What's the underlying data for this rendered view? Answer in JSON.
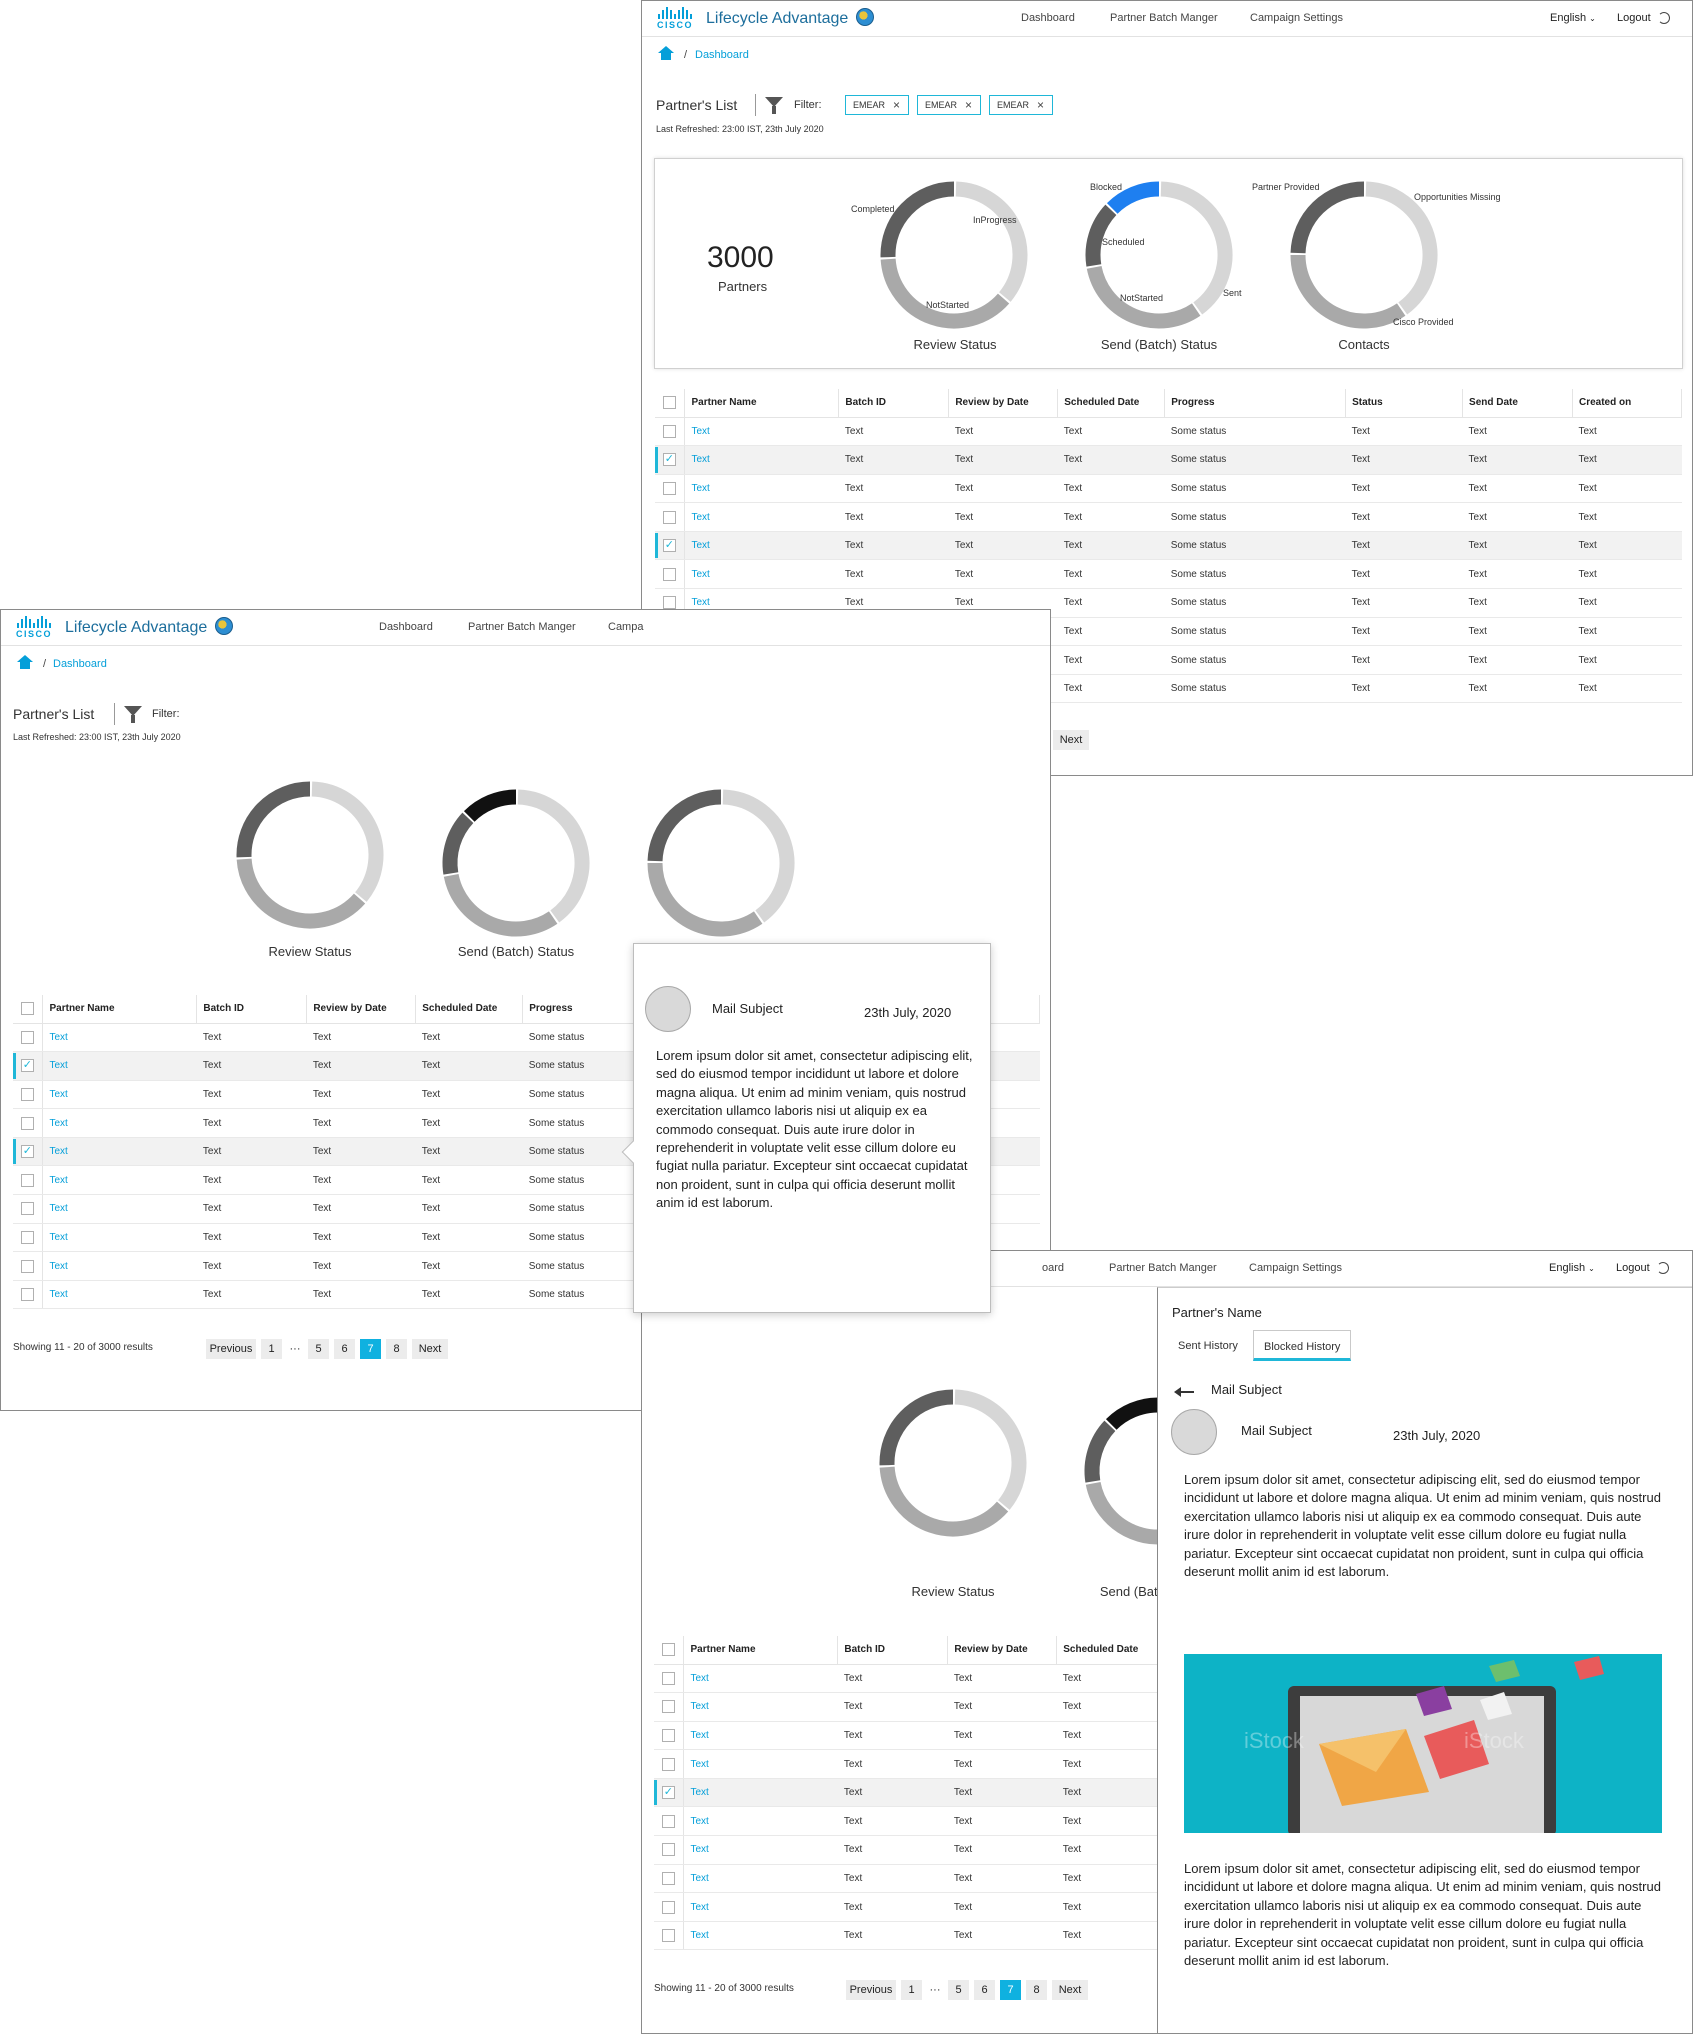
{
  "app": {
    "name": "Lifecycle Advantage",
    "nav": [
      "Dashboard",
      "Partner Batch Manger",
      "Campaign Settings"
    ],
    "nav_clipped": "Campa",
    "nav_clipped_left": "oard",
    "language": "English",
    "logout": "Logout",
    "logo_text": "CISCO"
  },
  "breadcrumb": {
    "current": "Dashboard",
    "separator": "/"
  },
  "list": {
    "title": "Partner's List",
    "filter_label": "Filter:",
    "chips": [
      "EMEAR",
      "EMEAR",
      "EMEAR"
    ],
    "last_refreshed": "Last Refreshed: 23:00 IST, 23th July 2020"
  },
  "summary": {
    "total": "3000",
    "total_label": "Partners",
    "charts": [
      {
        "title": "Review Status",
        "labels": [
          "Completed",
          "InProgress",
          "NotStarted"
        ],
        "segments": [
          {
            "label": "InProgress",
            "value": 0.36,
            "color": "#d6d6d6"
          },
          {
            "label": "NotStarted",
            "value": 0.38,
            "color": "#a9a9a9"
          },
          {
            "label": "Completed",
            "value": 0.26,
            "color": "#5e5e5e"
          }
        ]
      },
      {
        "title": "Send (Batch) Status",
        "labels": [
          "Blocked",
          "Scheduled",
          "NotStarted",
          "Sent"
        ],
        "segments": [
          {
            "label": "Sent",
            "value": 0.4,
            "color": "#d6d6d6"
          },
          {
            "label": "NotStarted",
            "value": 0.32,
            "color": "#a9a9a9"
          },
          {
            "label": "Scheduled",
            "value": 0.15,
            "color": "#5e5e5e"
          },
          {
            "label": "Blocked",
            "value": 0.13,
            "color": "#1e7ff0"
          }
        ]
      },
      {
        "title": "Contacts",
        "labels": [
          "Partner Provided",
          "Opportunities Missing",
          "Cisco Provided"
        ],
        "segments": [
          {
            "label": "Opportunities Missing",
            "value": 0.4,
            "color": "#d6d6d6"
          },
          {
            "label": "Cisco Provided",
            "value": 0.35,
            "color": "#a9a9a9"
          },
          {
            "label": "Partner Provided",
            "value": 0.25,
            "color": "#5e5e5e"
          }
        ]
      }
    ]
  },
  "table": {
    "columns": [
      "Partner Name",
      "Batch ID",
      "Review by Date",
      "Scheduled Date",
      "Progress",
      "Status",
      "Send Date",
      "Created on"
    ],
    "column_clipped": "on",
    "rows": [
      [
        "Text",
        "Text",
        "Text",
        "Text",
        "Some status",
        "Text",
        "Text",
        "Text"
      ],
      [
        "Text",
        "Text",
        "Text",
        "Text",
        "Some status",
        "Text",
        "Text",
        "Text"
      ],
      [
        "Text",
        "Text",
        "Text",
        "Text",
        "Some status",
        "Text",
        "Text",
        "Text"
      ],
      [
        "Text",
        "Text",
        "Text",
        "Text",
        "Some status",
        "Text",
        "Text",
        "Text"
      ],
      [
        "Text",
        "Text",
        "Text",
        "Text",
        "Some status",
        "Text",
        "Text",
        "Text"
      ],
      [
        "Text",
        "Text",
        "Text",
        "Text",
        "Some status",
        "Text",
        "Text",
        "Text"
      ],
      [
        "Text",
        "Text",
        "Text",
        "Text",
        "Some status",
        "Text",
        "Text",
        "Text"
      ],
      [
        "Text",
        "Text",
        "Text",
        "Text",
        "Some status",
        "Text",
        "Text",
        "Text"
      ],
      [
        "Text",
        "Text",
        "Text",
        "Text",
        "Some status",
        "Text",
        "Text",
        "Text"
      ],
      [
        "Text",
        "Text",
        "Text",
        "Text",
        "Some status",
        "Text",
        "Text",
        "Text"
      ]
    ],
    "selected_rows_a": [
      1,
      4
    ],
    "selected_rows_b": [
      4
    ]
  },
  "pagination": {
    "summary": "Showing 11 - 20 of 3000 results",
    "previous": "Previous",
    "next": "Next",
    "pages": [
      "1",
      "···",
      "5",
      "6",
      "7",
      "8"
    ],
    "active": "7"
  },
  "mail": {
    "subject": "Mail Subject",
    "date": "23th July, 2020",
    "body_popover": "Lorem ipsum dolor sit amet, consectetur adipiscing elit, sed do eiusmod tempor incididunt ut labore et dolore magna aliqua. Ut enim ad minim veniam, quis nostrud exercitation ullamco laboris nisi ut aliquip ex ea commodo consequat. Duis aute irure dolor in reprehenderit in voluptate velit esse cillum dolore eu fugiat nulla pariatur. Excepteur sint occaecat cupidatat non proident, sunt in culpa qui officia deserunt mollit anim id est laborum.",
    "body": "Lorem ipsum dolor sit amet, consectetur adipiscing elit, sed do eiusmod tempor incididunt ut labore et dolore magna aliqua. Ut enim ad minim veniam, quis nostrud exercitation ullamco laboris nisi ut aliquip ex ea commodo consequat. Duis aute irure dolor in reprehenderit in voluptate velit esse cillum dolore eu fugiat nulla pariatur. Excepteur sint occaecat cupidatat non proident, sunt in culpa qui officia deserunt mollit anim id est laborum.",
    "image_watermark": "iStock"
  },
  "side": {
    "partner_name": "Partner's Name",
    "tabs": [
      "Sent History",
      "Blocked History"
    ],
    "active_tab": "Blocked History",
    "back_label": "Mail Subject"
  }
}
